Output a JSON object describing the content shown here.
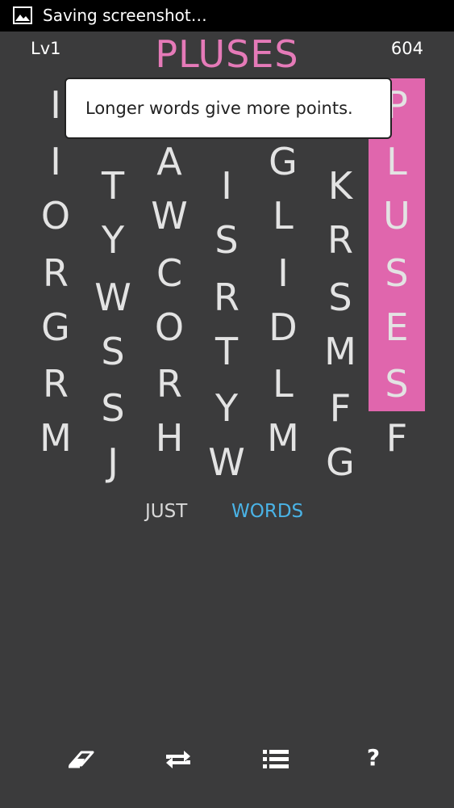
{
  "status_bar": {
    "text": "Saving screenshot…",
    "icon": "image-icon"
  },
  "header": {
    "level": "Lv1",
    "title": "PLUSES",
    "score": "604"
  },
  "tooltip": {
    "text": "Longer words give more points."
  },
  "colors": {
    "background": "#3b3b3c",
    "highlight": "#e066ad",
    "title": "#e57ab8",
    "current_word": "#4ab3e6"
  },
  "grid": {
    "highlighted_column": 6,
    "highlighted_word": "PLUSES",
    "columns": [
      [
        "I",
        "I",
        "O",
        "R",
        "G",
        "R",
        "M"
      ],
      [
        "",
        "T",
        "Y",
        "W",
        "S",
        "S",
        "J"
      ],
      [
        "",
        "A",
        "W",
        "C",
        "O",
        "R",
        "H"
      ],
      [
        "",
        "I",
        "S",
        "R",
        "T",
        "Y",
        "W"
      ],
      [
        "",
        "G",
        "L",
        "I",
        "D",
        "L",
        "M"
      ],
      [
        "",
        "K",
        "R",
        "S",
        "M",
        "F",
        "G"
      ],
      [
        "P",
        "L",
        "U",
        "S",
        "E",
        "S",
        "F"
      ]
    ]
  },
  "found_words": {
    "first": "JUST",
    "second": "WORDS"
  },
  "toolbar": {
    "buttons": [
      "eraser-icon",
      "repeat-icon",
      "list-icon",
      "help-icon"
    ],
    "help_label": "?"
  }
}
